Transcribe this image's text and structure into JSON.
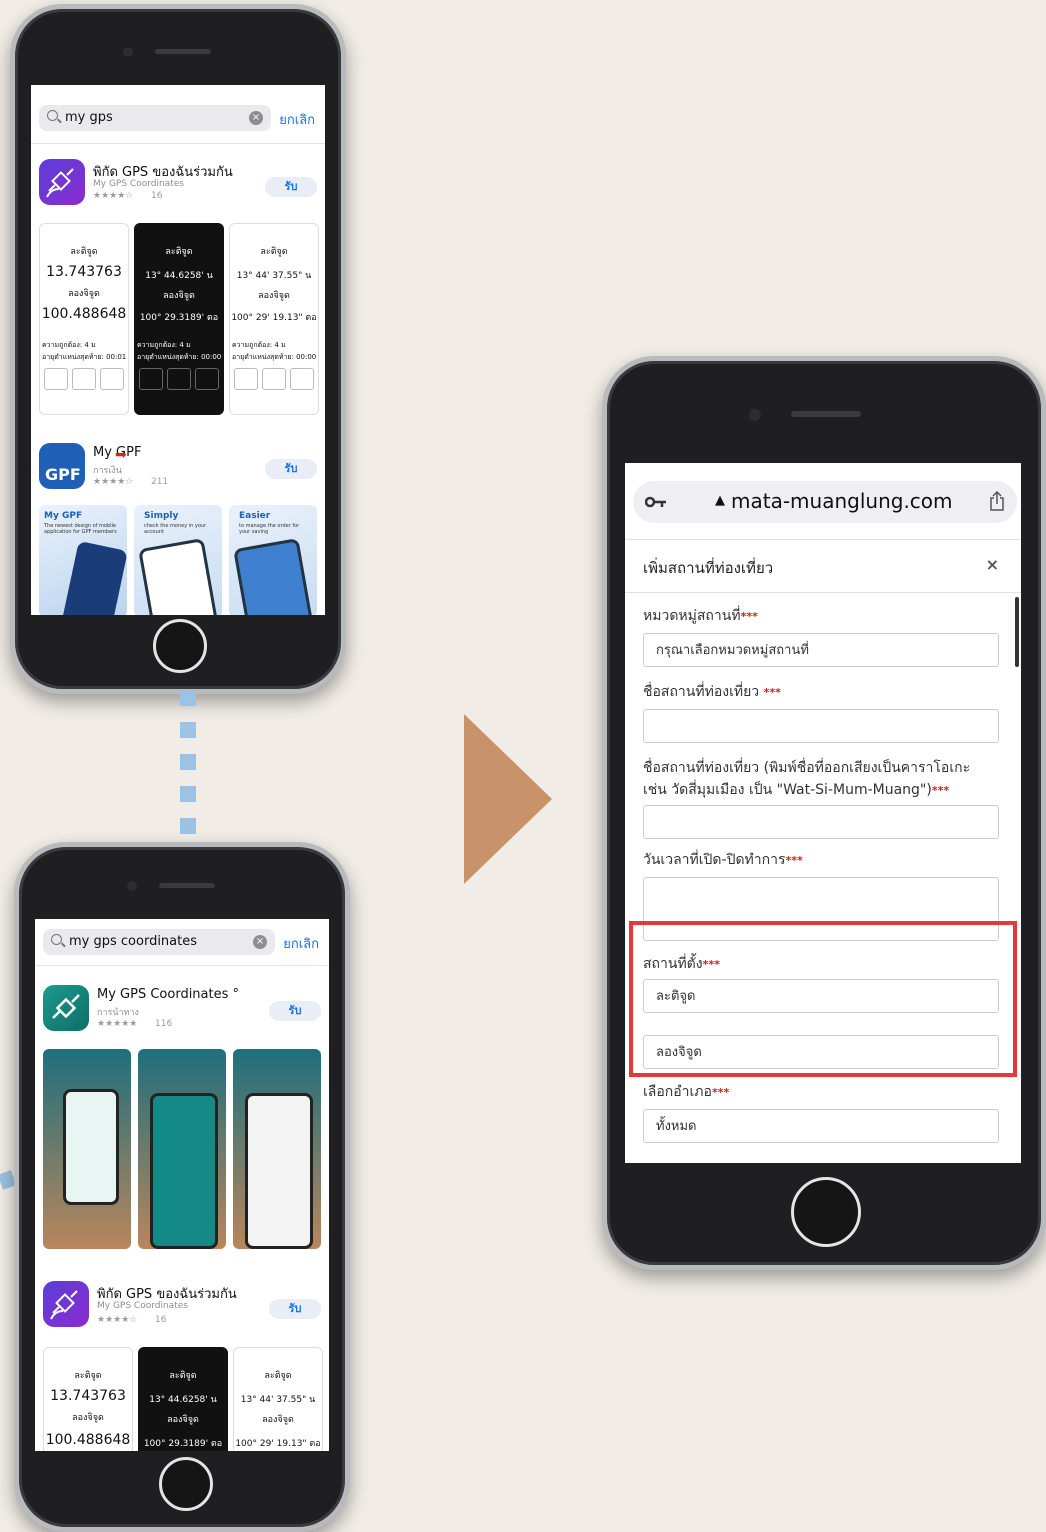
{
  "phone1": {
    "search_query": "my gps",
    "cancel_label": "ยกเลิก",
    "app1": {
      "name": "พิกัด GPS ของฉันร่วมกัน",
      "subtitle": "My GPS Coordinates",
      "stars": "★★★★☆",
      "rating_count": "16",
      "get_label": "รับ"
    },
    "screenshots": [
      {
        "lat_label": "ละติจูด",
        "lat_value": "13.743763",
        "lon_label": "ลองจิจูด",
        "lon_value": "100.488648",
        "accuracy": "ความถูกต้อง: 4 ม",
        "updated": "อายุตำแหน่งสุดท้าย: 00:01"
      },
      {
        "lat_label": "ละติจูด",
        "lat_value": "13° 44.6258' น",
        "lon_label": "ลองจิจูด",
        "lon_value": "100° 29.3189' ตอ",
        "accuracy": "ความถูกต้อง: 4 ม",
        "updated": "อายุตำแหน่งสุดท้าย: 00:00"
      },
      {
        "lat_label": "ละติจูด",
        "lat_value": "13° 44' 37.55\" น",
        "lon_label": "ลองจิจูด",
        "lon_value": "100° 29' 19.13\" ตอ",
        "accuracy": "ความถูกต้อง: 4 ม",
        "updated": "อายุตำแหน่งสุดท้าย: 00:00"
      }
    ],
    "app2": {
      "name": "My GPF",
      "subtitle": "การเงิน",
      "stars": "★★★★☆",
      "rating_count": "211",
      "get_label": "รับ",
      "icon_text": "GPF"
    },
    "promos": [
      {
        "title": "My GPF",
        "text": "The newest design of mobile application for GPF members"
      },
      {
        "title": "Simply",
        "text": "check the money in your account"
      },
      {
        "title": "Easier",
        "text": "to manage the order for your saving"
      }
    ]
  },
  "phone2": {
    "search_query": "my gps coordinates",
    "cancel_label": "ยกเลิก",
    "app1": {
      "name": "My GPS Coordinates °",
      "subtitle": "การนำทาง",
      "stars": "★★★★★",
      "rating_count": "116",
      "get_label": "รับ"
    },
    "app2": {
      "name": "พิกัด GPS ของฉันร่วมกัน",
      "subtitle": "My GPS Coordinates",
      "stars": "★★★★☆",
      "rating_count": "16",
      "get_label": "รับ"
    },
    "screenshots": [
      {
        "lat_label": "ละติจูด",
        "lat_value": "13.743763",
        "lon_label": "ลองจิจูด",
        "lon_value": "100.488648"
      },
      {
        "lat_label": "ละติจูด",
        "lat_value": "13° 44.6258' น",
        "lon_label": "ลองจิจูด",
        "lon_value": "100° 29.3189' ตอ"
      },
      {
        "lat_label": "ละติจูด",
        "lat_value": "13° 44' 37.55\" น",
        "lon_label": "ลองจิจูด",
        "lon_value": "100° 29' 19.13\" ตอ"
      }
    ]
  },
  "phone3": {
    "url": "mata-muanglung.com",
    "modal_title": "เพิ่มสถานที่ท่องเที่ยว",
    "close_label": "×",
    "required_mark": "***",
    "fields": {
      "category_label": "หมวดหมู่สถานที่",
      "category_placeholder": "กรุณาเลือกหมวดหมู่สถานที่",
      "name_label": "ชื่อสถานที่ท่องเที่ยว",
      "name_karaoke_label_line1": "ชื่อสถานที่ท่องเที่ยว (พิมพ์ชื่อที่ออกเสียงเป็นคาราโอเกะ",
      "name_karaoke_label_line2": "เช่น วัดสี่มุมเมือง เป็น \"Wat-Si-Mum-Muang\")",
      "hours_label": "วันเวลาที่เปิด-ปิดทำการ",
      "location_label": "สถานที่ตั้ง",
      "latitude_placeholder": "ละติจูด",
      "longitude_placeholder": "ลองจิจูด",
      "district_label": "เลือกอำเภอ",
      "district_value": "ทั้งหมด"
    }
  },
  "colors": {
    "arrow": "#c8926a",
    "highlight": "#e53935",
    "link": "#1a73e8",
    "connector": "#9cc3e3"
  }
}
